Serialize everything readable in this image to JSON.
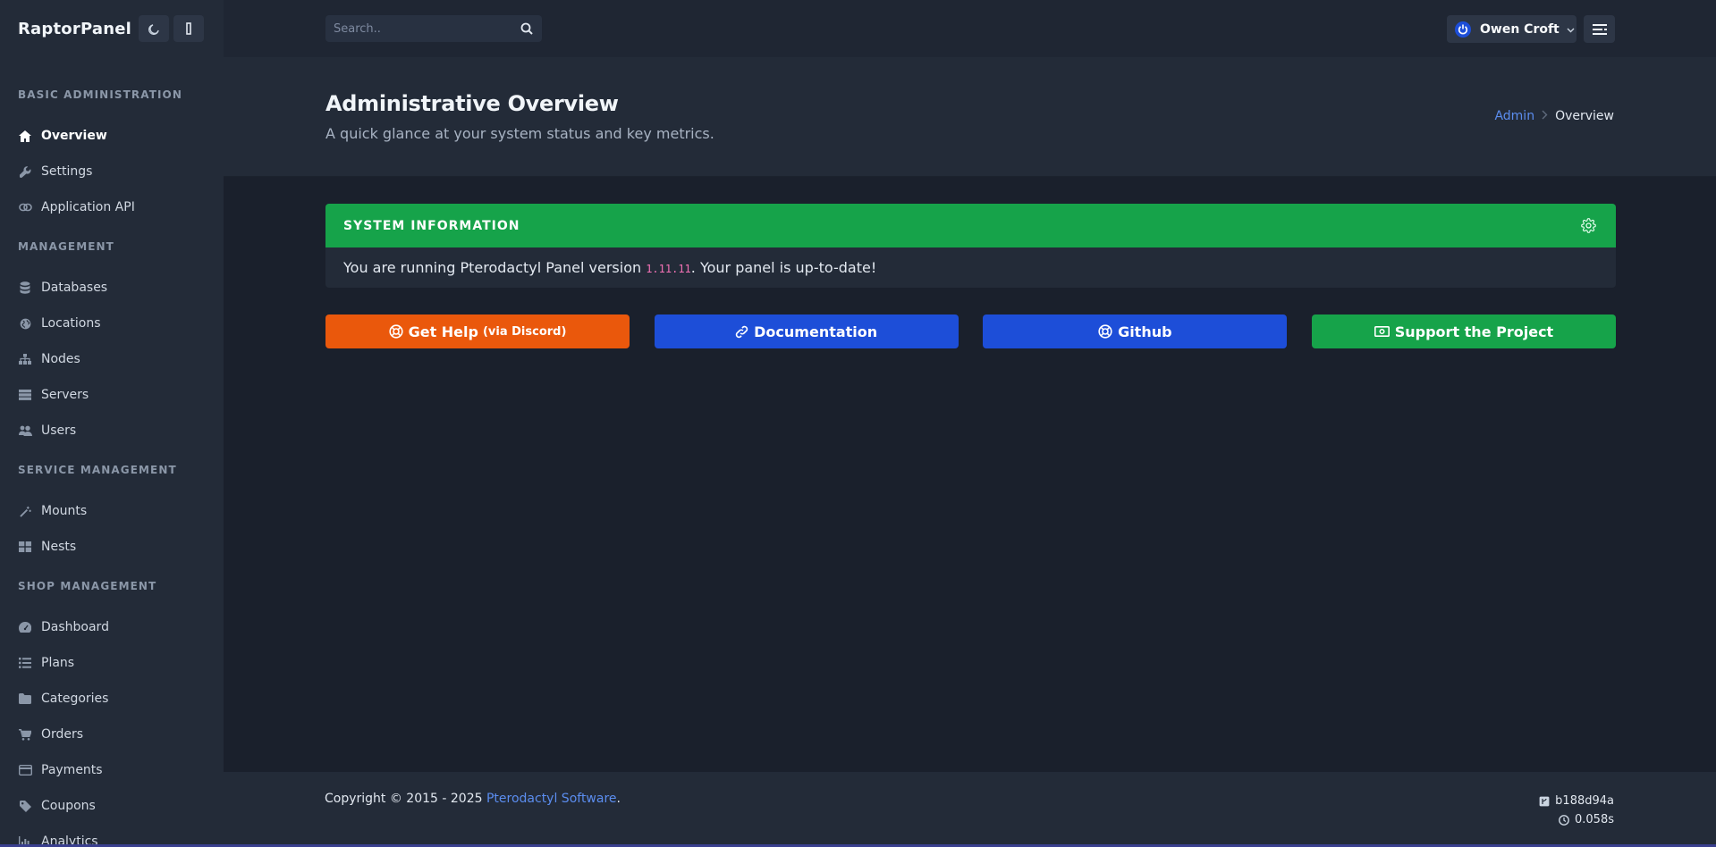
{
  "brand": {
    "name": "RaptorPanel",
    "theme_icon": "moon-icon",
    "sidebar_toggle_icon": "sidebar-toggle-icon"
  },
  "search": {
    "placeholder": "Search..",
    "icon": "search-icon"
  },
  "user": {
    "name": "Owen Croft",
    "avatar_icon": "power-icon",
    "menu_icon": "menu-lines-icon"
  },
  "sidebar": {
    "sections": [
      {
        "title": "BASIC ADMINISTRATION",
        "items": [
          {
            "label": "Overview",
            "icon": "home-icon",
            "active": true
          },
          {
            "label": "Settings",
            "icon": "wrench-icon"
          },
          {
            "label": "Application API",
            "icon": "link-icon"
          }
        ]
      },
      {
        "title": "MANAGEMENT",
        "items": [
          {
            "label": "Databases",
            "icon": "database-icon"
          },
          {
            "label": "Locations",
            "icon": "globe-icon"
          },
          {
            "label": "Nodes",
            "icon": "sitemap-icon"
          },
          {
            "label": "Servers",
            "icon": "server-icon"
          },
          {
            "label": "Users",
            "icon": "users-icon"
          }
        ]
      },
      {
        "title": "SERVICE MANAGEMENT",
        "items": [
          {
            "label": "Mounts",
            "icon": "magic-wand-icon"
          },
          {
            "label": "Nests",
            "icon": "grid-icon"
          }
        ]
      },
      {
        "title": "SHOP MANAGEMENT",
        "items": [
          {
            "label": "Dashboard",
            "icon": "gauge-icon"
          },
          {
            "label": "Plans",
            "icon": "list-icon"
          },
          {
            "label": "Categories",
            "icon": "folder-icon"
          },
          {
            "label": "Orders",
            "icon": "cart-icon"
          },
          {
            "label": "Payments",
            "icon": "credit-card-icon"
          },
          {
            "label": "Coupons",
            "icon": "tag-icon"
          },
          {
            "label": "Analytics",
            "icon": "bar-chart-icon"
          }
        ]
      }
    ]
  },
  "header": {
    "title": "Administrative Overview",
    "subtitle": "A quick glance at your system status and key metrics.",
    "breadcrumb": {
      "root": "Admin",
      "current": "Overview"
    }
  },
  "system_info": {
    "title": "SYSTEM INFORMATION",
    "text_before": "You are running Pterodactyl Panel version ",
    "version": "1.11.11",
    "text_after": ". Your panel is up-to-date!"
  },
  "buttons": {
    "help": {
      "label": "Get Help",
      "sub": "(via Discord)",
      "color": "#ea580c"
    },
    "docs": {
      "label": "Documentation",
      "color": "#1d4ed8"
    },
    "github": {
      "label": "Github",
      "color": "#1d4ed8"
    },
    "support": {
      "label": "Support the Project",
      "color": "#16a34a"
    }
  },
  "footer": {
    "copyright_prefix": "Copyright © 2015 - 2025 ",
    "copyright_link": "Pterodactyl Software",
    "copyright_suffix": ".",
    "commit": "b188d94a",
    "time": "0.058s"
  },
  "colors": {
    "accent_green": "#16a34a",
    "accent_blue": "#1d4ed8",
    "accent_orange": "#ea580c",
    "link": "#5b8def"
  }
}
